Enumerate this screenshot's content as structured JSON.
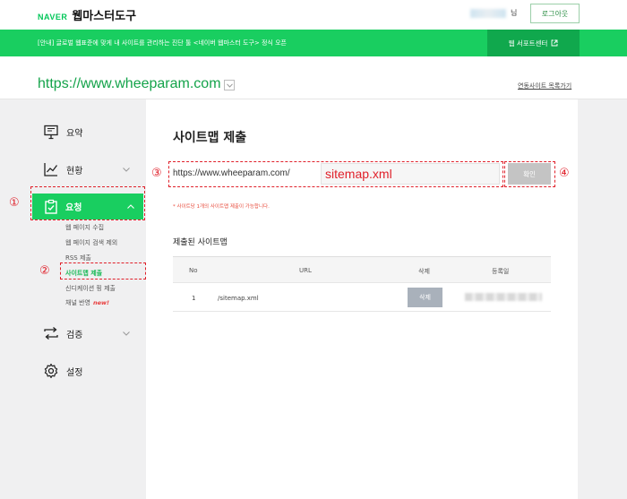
{
  "header": {
    "brand": "NAVER",
    "product": "웹마스터도구",
    "user_suffix": "님",
    "logout_label": "로그아웃"
  },
  "notice": {
    "text": "[안내] 글로벌 웹표준에 맞게 내 사이트를 관리하는 진단 툴 <네이버 웹마스터 도구> 정식 오픈",
    "button_label": "웹 서포트센터"
  },
  "site": {
    "url": "https://www.wheeparam.com",
    "list_link": "연동사이트 목록가기"
  },
  "sidebar": {
    "items": [
      {
        "label": "요약",
        "icon": "board-icon"
      },
      {
        "label": "현황",
        "icon": "chart-icon"
      },
      {
        "label": "요청",
        "icon": "clipboard-icon"
      },
      {
        "label": "검증",
        "icon": "swap-icon"
      },
      {
        "label": "설정",
        "icon": "gear-icon"
      }
    ],
    "sub_items": [
      {
        "label": "웹 페이지 수집"
      },
      {
        "label": "웹 페이지 검색 제외"
      },
      {
        "label": "RSS 제출"
      },
      {
        "label": "사이트맵 제출"
      },
      {
        "label": "신디케이션 핑 제출"
      },
      {
        "label": "채널 반영",
        "badge": "new!"
      }
    ]
  },
  "annotations": [
    "①",
    "②",
    "③",
    "④"
  ],
  "main": {
    "title": "사이트맵 제출",
    "url_prefix": "https://www.wheeparam.com/",
    "input_value": "sitemap.xml",
    "confirm_label": "확인",
    "note": "* 사이트당 1개의 사이트맵 제출이 가능합니다.",
    "submitted_title": "제출된 사이트맵",
    "table": {
      "columns": [
        "No",
        "URL",
        "삭제",
        "등록일"
      ],
      "rows": [
        {
          "no": "1",
          "url": "/sitemap.xml",
          "delete_label": "삭제"
        }
      ]
    }
  },
  "colors": {
    "accent": "#19ce60",
    "annotation": "#e0202a",
    "site_url": "#14a34a"
  }
}
